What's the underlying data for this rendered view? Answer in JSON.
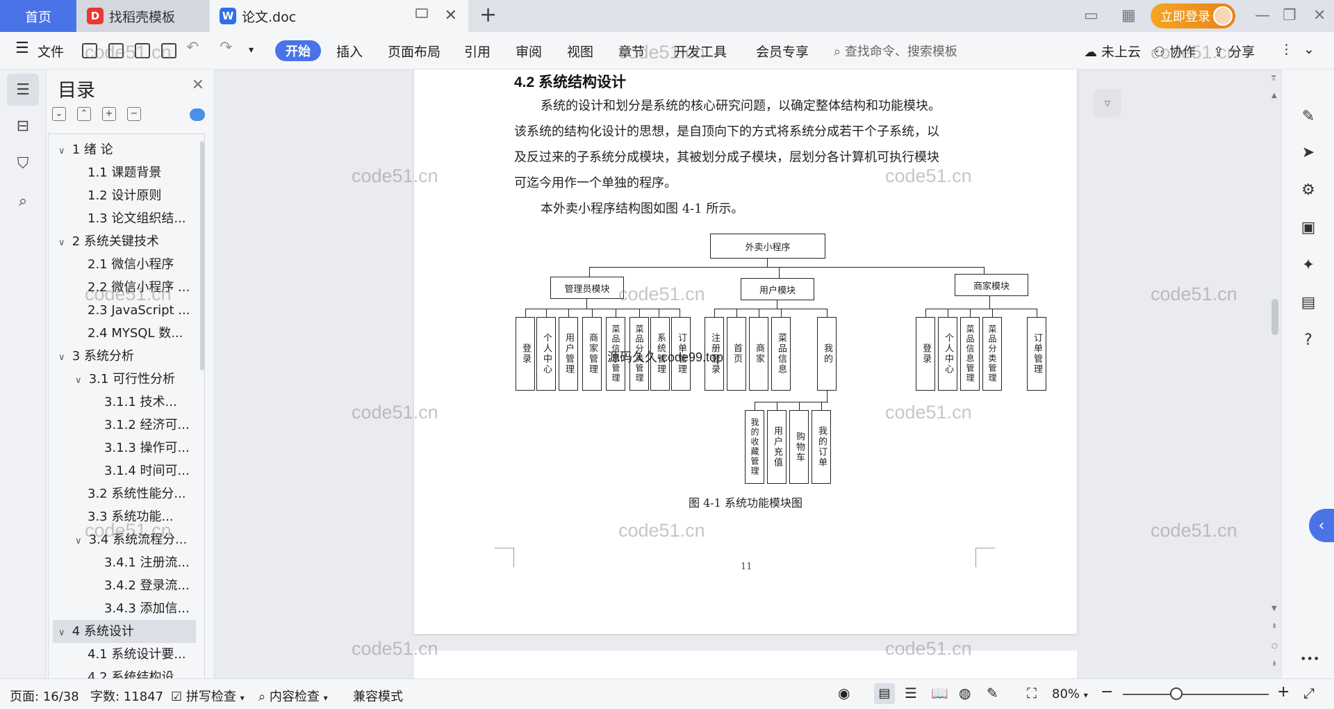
{
  "tabs": {
    "home": "首页",
    "template": "找稻壳模板",
    "document": "论文.doc",
    "login": "立即登录"
  },
  "menu": {
    "file": "文件",
    "items": [
      "开始",
      "插入",
      "页面布局",
      "引用",
      "审阅",
      "视图",
      "章节",
      "开发工具",
      "会员专享"
    ],
    "search_placeholder": "查找命令、搜索模板",
    "cloud": "未上云",
    "collab": "协作",
    "share": "分享"
  },
  "toc": {
    "title": "目录",
    "items": [
      "1 绪 论",
      "1.1 课题背景",
      "1.2 设计原则",
      "1.3 论文组织结...",
      "2 系统关键技术",
      "2.1 微信小程序",
      "2.2 微信小程序 ...",
      "2.3 JavaScript ...",
      "2.4 MYSQL 数...",
      "3 系统分析",
      "3.1 可行性分析",
      "3.1.1  技术...",
      "3.1.2 经济可...",
      "3.1.3 操作可...",
      "3.1.4 时间可...",
      "3.2 系统性能分...",
      "3.3    系统功能...",
      "3.4 系统流程分...",
      "3.4.1 注册流...",
      "3.4.2 登录流...",
      "3.4.3 添加信...",
      "4 系统设计",
      "4.1 系统设计要...",
      "4.2 系统结构设..."
    ]
  },
  "document": {
    "heading": "4.2 系统结构设计",
    "para1": [
      "系统的设计和划分是系统的核心研究问题，以确定整体结构和功能模块。",
      "该系统的结构化设计的思想，是自顶向下的方式将系统分成若干个子系统，以",
      "及反过来的子系统分成模块，其被划分成子模块，层划分各计算机可执行模块",
      "可迄今用作一个单独的程序。"
    ],
    "para2": "本外卖小程序结构图如图 4-1 所示。",
    "figure_caption": "图 4-1  系统功能模块图",
    "page_number": "11",
    "chart": {
      "root": "外卖小程序",
      "modules": [
        "管理员模块",
        "用户模块",
        "商家模块"
      ],
      "admin_children": [
        "登录",
        "个人中心",
        "用户管理",
        "商家管理",
        "菜品信息管理",
        "菜品分类管理",
        "系统管理",
        "订单管理"
      ],
      "user_children": [
        "注册登录",
        "首页",
        "商家",
        "菜品信息",
        "我的"
      ],
      "merchant_children": [
        "登录",
        "个人中心",
        "菜品信息管理",
        "菜品分类管理",
        "订单管理"
      ],
      "my_children": [
        "我的收藏管理",
        "用户充值",
        "购物车",
        "我的订单"
      ]
    },
    "overlay_text": "源码久久-code99.top",
    "watermark": "code51.cn"
  },
  "status": {
    "page": "页面: 16/38",
    "words": "字数: 11847",
    "spell": "拼写检查",
    "content_check": "内容检查",
    "compat": "兼容模式",
    "zoom": "80%"
  }
}
